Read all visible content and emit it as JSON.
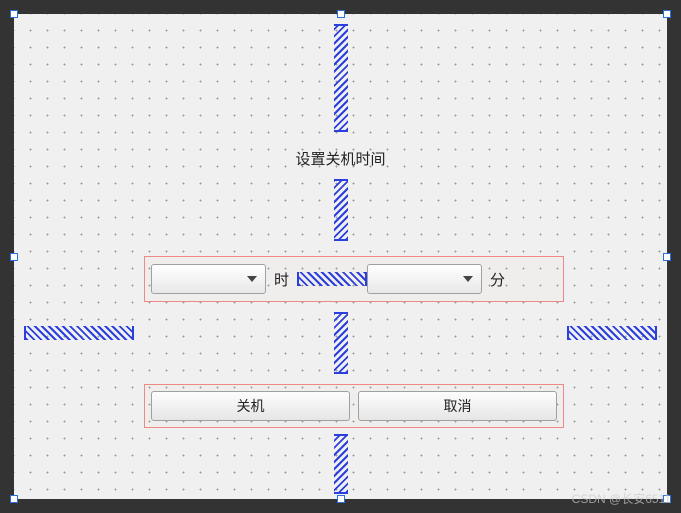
{
  "title": "设置关机时间",
  "time_row": {
    "hour_combo_value": "",
    "hour_label": "时",
    "minute_combo_value": "",
    "minute_label": "分"
  },
  "actions": {
    "shutdown": "关机",
    "cancel": "取消"
  },
  "watermark": "CSDN @长安6511"
}
